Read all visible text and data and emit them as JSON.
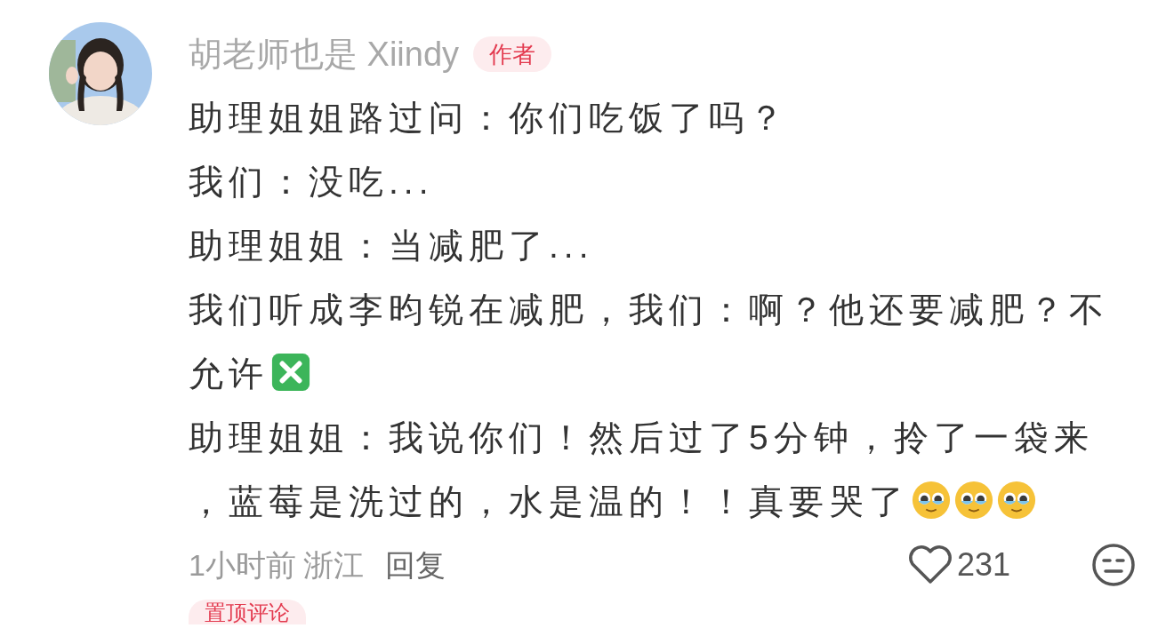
{
  "comment": {
    "author": "胡老师也是 Xiindy",
    "author_badge": "作者",
    "lines": [
      {
        "text": "助理姐姐路过问：你们吃饭了吗？"
      },
      {
        "text": "我们：没吃..."
      },
      {
        "text": "助理姐姐：当减肥了..."
      },
      {
        "text": "我们听成李昀锐在减肥，我们：啊？他还要减肥？不允许",
        "icons": [
          {
            "kind": "cross"
          }
        ]
      },
      {
        "text": "助理姐姐：我说你们！然后过了5分钟，拎了一袋来，蓝莓是洗过的，水是温的！！真要哭了",
        "icons": [
          {
            "kind": "teary-face"
          },
          {
            "kind": "teary-face"
          },
          {
            "kind": "teary-face"
          }
        ]
      }
    ],
    "time": "1小时前",
    "location": "浙江",
    "reply": "回复",
    "likes": "231",
    "liked": false
  },
  "next_tag": "置顶评论"
}
